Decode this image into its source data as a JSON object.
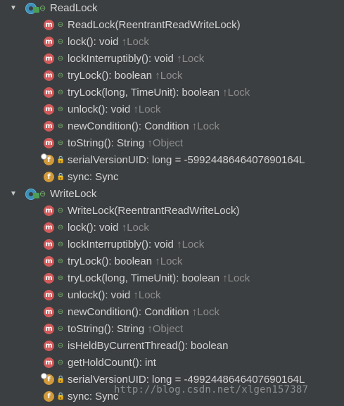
{
  "tree": {
    "readlock": {
      "arrow": "▼",
      "name": "ReadLock",
      "members": [
        {
          "kind": "m",
          "vis": "public",
          "sig": "ReadLock(ReentrantReadWriteLock)",
          "owner": ""
        },
        {
          "kind": "m",
          "vis": "public",
          "sig": "lock(): void ",
          "owner": "↑Lock"
        },
        {
          "kind": "m",
          "vis": "public",
          "sig": "lockInterruptibly(): void ",
          "owner": "↑Lock"
        },
        {
          "kind": "m",
          "vis": "public",
          "sig": "tryLock(): boolean ",
          "owner": "↑Lock"
        },
        {
          "kind": "m",
          "vis": "public",
          "sig": "tryLock(long, TimeUnit): boolean ",
          "owner": "↑Lock"
        },
        {
          "kind": "m",
          "vis": "public",
          "sig": "unlock(): void ",
          "owner": "↑Lock"
        },
        {
          "kind": "m",
          "vis": "public",
          "sig": "newCondition(): Condition ",
          "owner": "↑Lock"
        },
        {
          "kind": "m",
          "vis": "public",
          "sig": "toString(): String ",
          "owner": "↑Object"
        },
        {
          "kind": "f",
          "vis": "private",
          "static": true,
          "sig": "serialVersionUID: long = -5992448646407690164L",
          "owner": ""
        },
        {
          "kind": "f",
          "vis": "private",
          "sig": "sync: Sync",
          "owner": ""
        }
      ]
    },
    "writelock": {
      "arrow": "▼",
      "name": "WriteLock",
      "members": [
        {
          "kind": "m",
          "vis": "public",
          "sig": "WriteLock(ReentrantReadWriteLock)",
          "owner": ""
        },
        {
          "kind": "m",
          "vis": "public",
          "sig": "lock(): void ",
          "owner": "↑Lock"
        },
        {
          "kind": "m",
          "vis": "public",
          "sig": "lockInterruptibly(): void ",
          "owner": "↑Lock"
        },
        {
          "kind": "m",
          "vis": "public",
          "sig": "tryLock(): boolean ",
          "owner": "↑Lock"
        },
        {
          "kind": "m",
          "vis": "public",
          "sig": "tryLock(long, TimeUnit): boolean ",
          "owner": "↑Lock"
        },
        {
          "kind": "m",
          "vis": "public",
          "sig": "unlock(): void ",
          "owner": "↑Lock"
        },
        {
          "kind": "m",
          "vis": "public",
          "sig": "newCondition(): Condition ",
          "owner": "↑Lock"
        },
        {
          "kind": "m",
          "vis": "public",
          "sig": "toString(): String ",
          "owner": "↑Object"
        },
        {
          "kind": "m",
          "vis": "public",
          "sig": "isHeldByCurrentThread(): boolean",
          "owner": ""
        },
        {
          "kind": "m",
          "vis": "public",
          "sig": "getHoldCount(): int",
          "owner": ""
        },
        {
          "kind": "f",
          "vis": "private",
          "static": true,
          "sig": "serialVersionUID: long = -4992448646407690164L",
          "owner": ""
        },
        {
          "kind": "f",
          "vis": "private",
          "sig": "sync: Sync",
          "owner": ""
        }
      ]
    }
  },
  "icons": {
    "method_letter": "m",
    "field_letter": "f",
    "public_symbol": "⊖",
    "private_symbol": "🔒",
    "colors": {
      "method": "#d25a5a",
      "field": "#d29a3a",
      "class": "#3e8fb8",
      "public": "#78b46c",
      "private": "#e0604d",
      "inherited": "#8d8d8d",
      "background": "#3c3f41"
    }
  },
  "watermark": "http://blog.csdn.net/xlgen157387"
}
